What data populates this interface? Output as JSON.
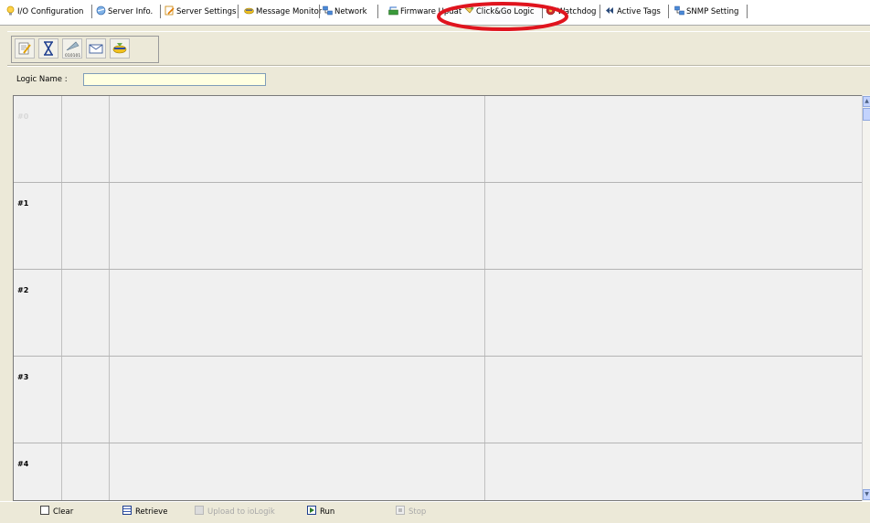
{
  "tabs": [
    {
      "label": "I/O Configuration",
      "icon": "lightbulb-icon"
    },
    {
      "label": "Server Info.",
      "icon": "server-info-icon"
    },
    {
      "label": "Server Settings",
      "icon": "server-settings-icon"
    },
    {
      "label": "Message Monitor",
      "icon": "message-monitor-icon"
    },
    {
      "label": "Network",
      "icon": "network-icon"
    },
    {
      "label": "Firmware Update",
      "icon": "firmware-icon"
    },
    {
      "label": "Click&Go Logic",
      "icon": "logic-icon",
      "selected": true
    },
    {
      "label": "Watchdog",
      "icon": "watchdog-icon"
    },
    {
      "label": "Active Tags",
      "icon": "active-tags-icon"
    },
    {
      "label": "SNMP Setting",
      "icon": "snmp-icon"
    }
  ],
  "toolbar": {
    "buttons": [
      "edit-icon",
      "timer-icon",
      "binary-upload-icon",
      "mail-icon",
      "export-icon"
    ]
  },
  "logic_name": {
    "label": "Logic Name :",
    "value": ""
  },
  "rules": [
    {
      "label": "#0"
    },
    {
      "label": "#1"
    },
    {
      "label": "#2"
    },
    {
      "label": "#3"
    },
    {
      "label": "#4"
    }
  ],
  "bottom": {
    "clear": "Clear",
    "retrieve": "Retrieve",
    "upload": "Upload to ioLogik",
    "run": "Run",
    "stop": "Stop"
  },
  "colors": {
    "highlight_ring": "#e0141e",
    "input_bg": "#ffffe1"
  }
}
